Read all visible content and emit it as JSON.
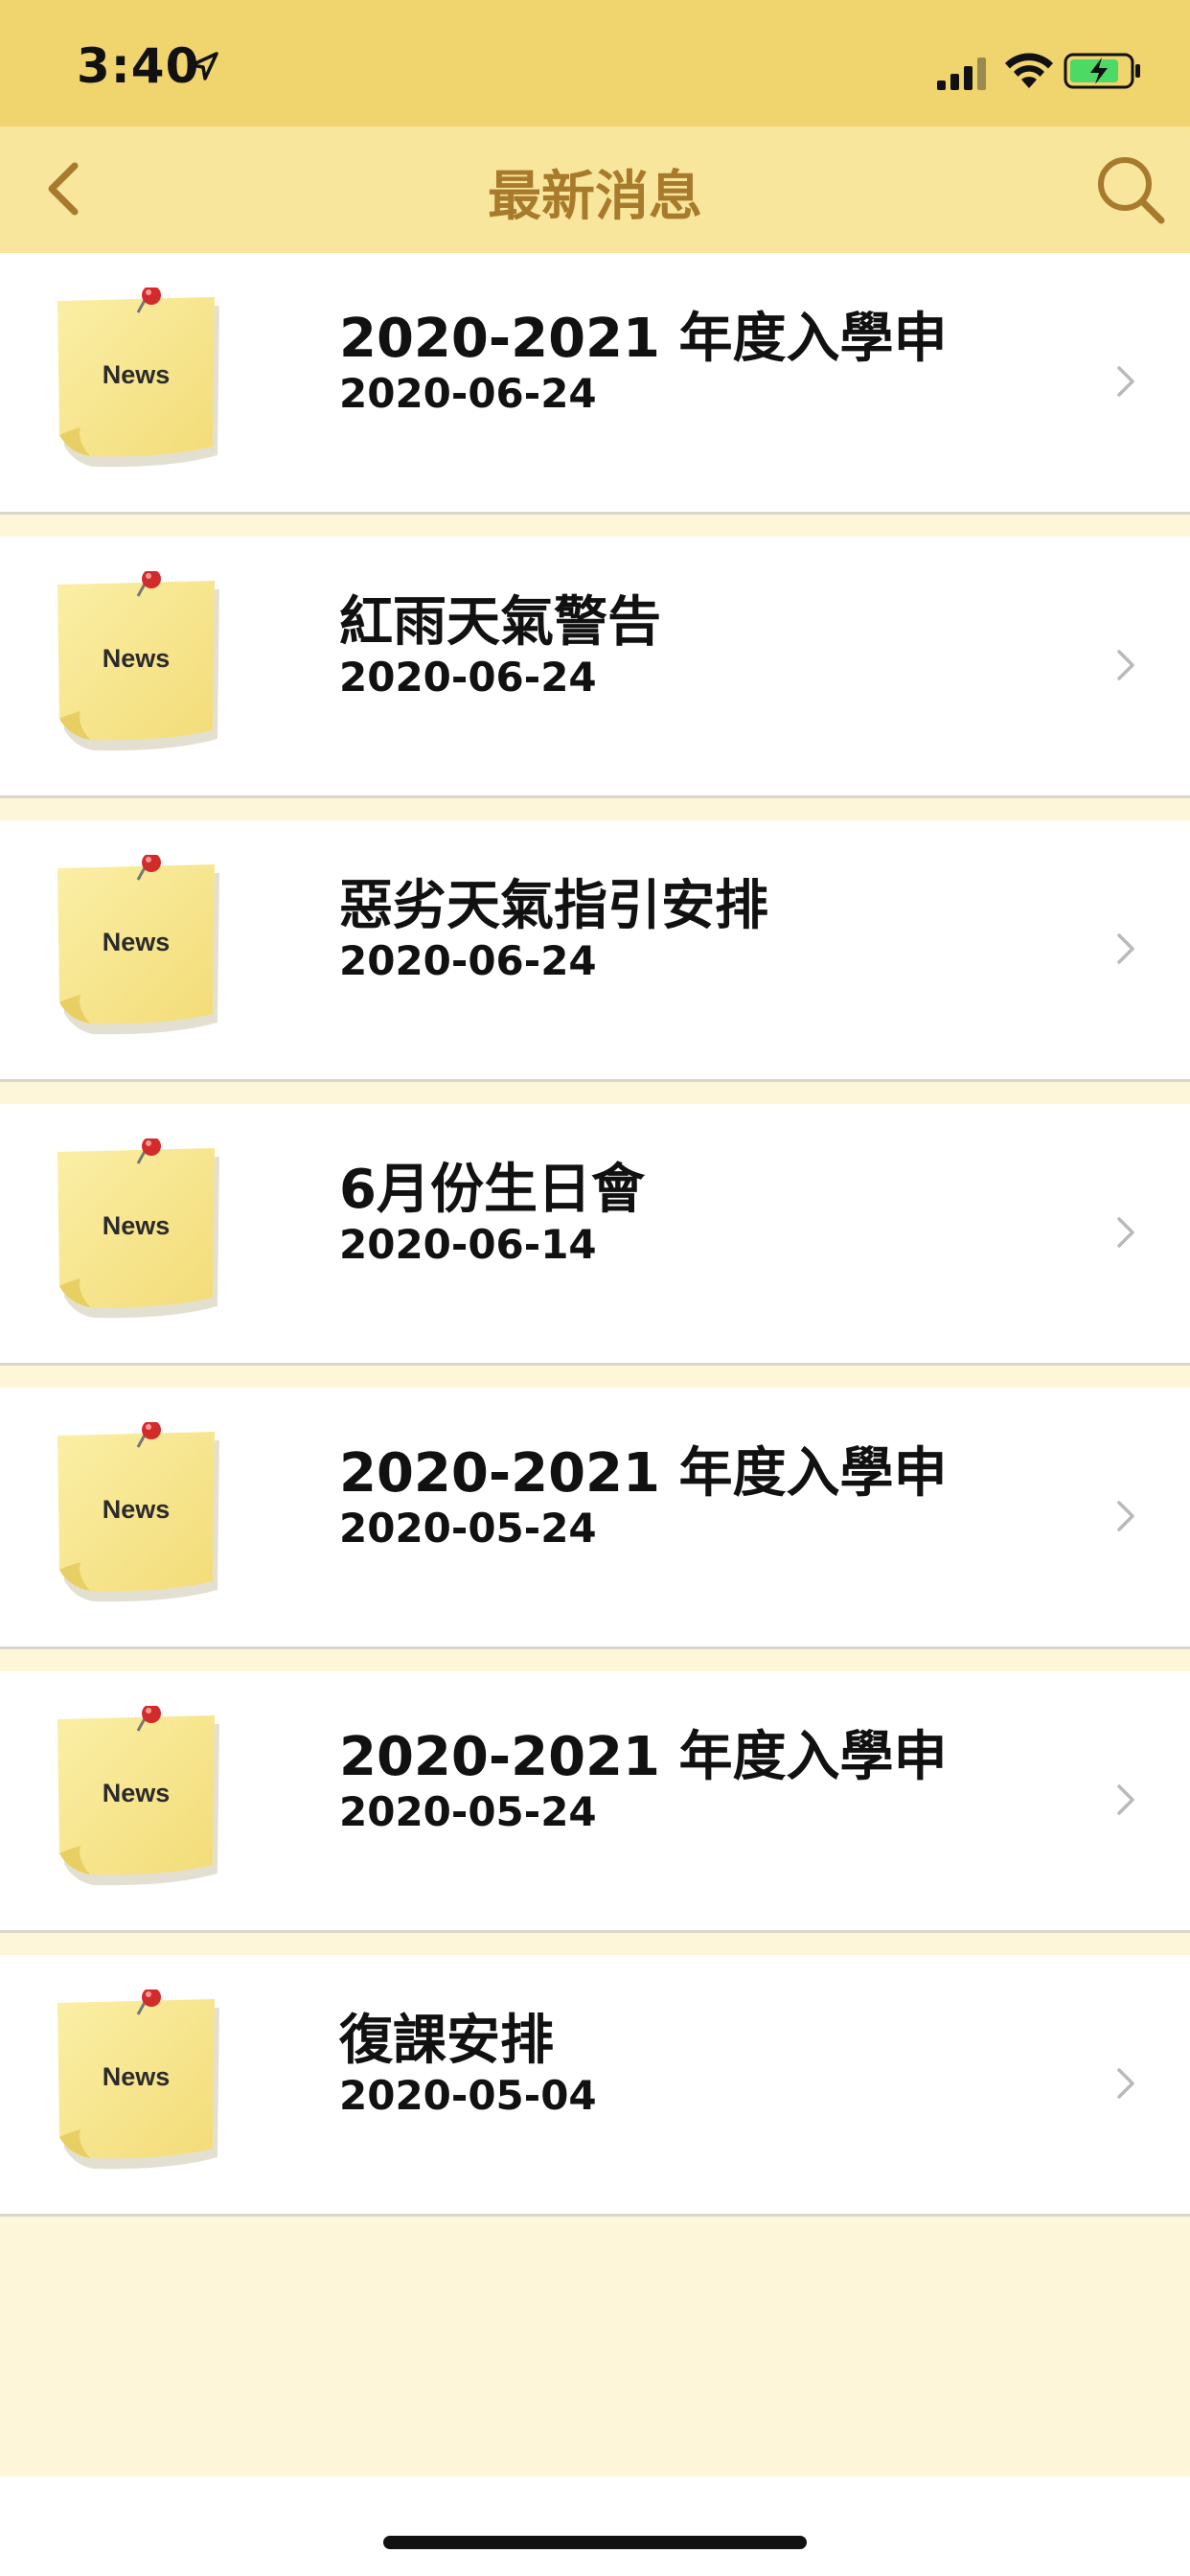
{
  "status_bar": {
    "time": "3:40"
  },
  "nav": {
    "title": "最新消息",
    "back_icon": "chevron-left-icon",
    "search_icon": "search-icon"
  },
  "colors": {
    "status_bar": "#f0d46e",
    "nav_bar": "#f8e69c",
    "title": "#a87a2c",
    "page_bg": "#fdf6d8"
  },
  "news_items": [
    {
      "title": "2020-2021 年度入學申",
      "truncated": true,
      "date": "2020-06-24",
      "icon_label": "News"
    },
    {
      "title": "紅雨天氣警告",
      "truncated": false,
      "date": "2020-06-24",
      "icon_label": "News"
    },
    {
      "title": "惡劣天氣指引安排",
      "truncated": false,
      "date": "2020-06-24",
      "icon_label": "News"
    },
    {
      "title": "6月份生日會",
      "truncated": false,
      "date": "2020-06-14",
      "icon_label": "News"
    },
    {
      "title": "2020-2021 年度入學申",
      "truncated": true,
      "date": "2020-05-24",
      "icon_label": "News"
    },
    {
      "title": "2020-2021 年度入學申",
      "truncated": true,
      "date": "2020-05-24",
      "icon_label": "News"
    },
    {
      "title": "復課安排",
      "truncated": false,
      "date": "2020-05-04",
      "icon_label": "News"
    }
  ]
}
